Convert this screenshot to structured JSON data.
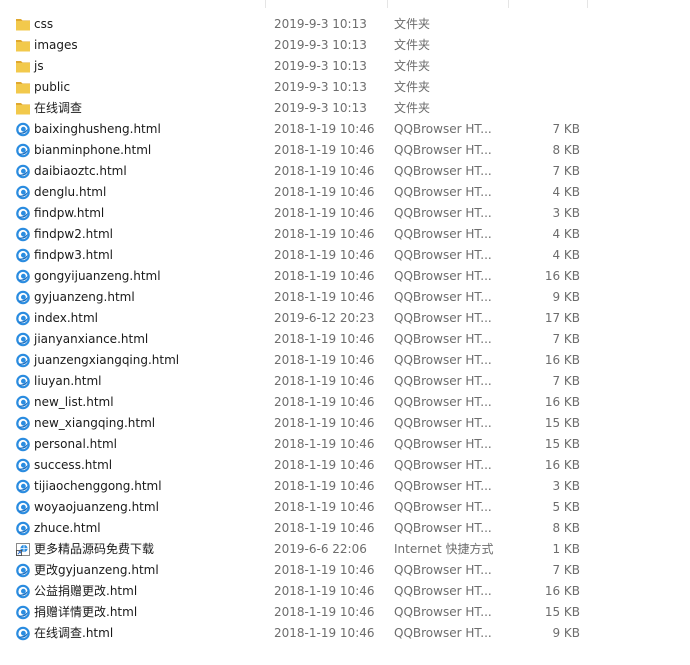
{
  "files": [
    {
      "name": "css",
      "date": "2019-9-3 10:13",
      "type": "文件夹",
      "size": "",
      "icon": "folder-icon"
    },
    {
      "name": "images",
      "date": "2019-9-3 10:13",
      "type": "文件夹",
      "size": "",
      "icon": "folder-icon"
    },
    {
      "name": "js",
      "date": "2019-9-3 10:13",
      "type": "文件夹",
      "size": "",
      "icon": "folder-icon"
    },
    {
      "name": "public",
      "date": "2019-9-3 10:13",
      "type": "文件夹",
      "size": "",
      "icon": "folder-icon"
    },
    {
      "name": "在线调查",
      "date": "2019-9-3 10:13",
      "type": "文件夹",
      "size": "",
      "icon": "folder-icon"
    },
    {
      "name": "baixinghusheng.html",
      "date": "2018-1-19 10:46",
      "type": "QQBrowser HT...",
      "size": "7 KB",
      "icon": "qqbrowser-html-icon"
    },
    {
      "name": "bianminphone.html",
      "date": "2018-1-19 10:46",
      "type": "QQBrowser HT...",
      "size": "8 KB",
      "icon": "qqbrowser-html-icon"
    },
    {
      "name": "daibiaoztc.html",
      "date": "2018-1-19 10:46",
      "type": "QQBrowser HT...",
      "size": "7 KB",
      "icon": "qqbrowser-html-icon"
    },
    {
      "name": "denglu.html",
      "date": "2018-1-19 10:46",
      "type": "QQBrowser HT...",
      "size": "4 KB",
      "icon": "qqbrowser-html-icon"
    },
    {
      "name": "findpw.html",
      "date": "2018-1-19 10:46",
      "type": "QQBrowser HT...",
      "size": "3 KB",
      "icon": "qqbrowser-html-icon"
    },
    {
      "name": "findpw2.html",
      "date": "2018-1-19 10:46",
      "type": "QQBrowser HT...",
      "size": "4 KB",
      "icon": "qqbrowser-html-icon"
    },
    {
      "name": "findpw3.html",
      "date": "2018-1-19 10:46",
      "type": "QQBrowser HT...",
      "size": "4 KB",
      "icon": "qqbrowser-html-icon"
    },
    {
      "name": "gongyijuanzeng.html",
      "date": "2018-1-19 10:46",
      "type": "QQBrowser HT...",
      "size": "16 KB",
      "icon": "qqbrowser-html-icon"
    },
    {
      "name": "gyjuanzeng.html",
      "date": "2018-1-19 10:46",
      "type": "QQBrowser HT...",
      "size": "9 KB",
      "icon": "qqbrowser-html-icon"
    },
    {
      "name": "index.html",
      "date": "2019-6-12 20:23",
      "type": "QQBrowser HT...",
      "size": "17 KB",
      "icon": "qqbrowser-html-icon"
    },
    {
      "name": "jianyanxiance.html",
      "date": "2018-1-19 10:46",
      "type": "QQBrowser HT...",
      "size": "7 KB",
      "icon": "qqbrowser-html-icon"
    },
    {
      "name": "juanzengxiangqing.html",
      "date": "2018-1-19 10:46",
      "type": "QQBrowser HT...",
      "size": "16 KB",
      "icon": "qqbrowser-html-icon"
    },
    {
      "name": "liuyan.html",
      "date": "2018-1-19 10:46",
      "type": "QQBrowser HT...",
      "size": "7 KB",
      "icon": "qqbrowser-html-icon"
    },
    {
      "name": "new_list.html",
      "date": "2018-1-19 10:46",
      "type": "QQBrowser HT...",
      "size": "16 KB",
      "icon": "qqbrowser-html-icon"
    },
    {
      "name": "new_xiangqing.html",
      "date": "2018-1-19 10:46",
      "type": "QQBrowser HT...",
      "size": "15 KB",
      "icon": "qqbrowser-html-icon"
    },
    {
      "name": "personal.html",
      "date": "2018-1-19 10:46",
      "type": "QQBrowser HT...",
      "size": "15 KB",
      "icon": "qqbrowser-html-icon"
    },
    {
      "name": "success.html",
      "date": "2018-1-19 10:46",
      "type": "QQBrowser HT...",
      "size": "16 KB",
      "icon": "qqbrowser-html-icon"
    },
    {
      "name": "tijiaochenggong.html",
      "date": "2018-1-19 10:46",
      "type": "QQBrowser HT...",
      "size": "3 KB",
      "icon": "qqbrowser-html-icon"
    },
    {
      "name": "woyaojuanzeng.html",
      "date": "2018-1-19 10:46",
      "type": "QQBrowser HT...",
      "size": "5 KB",
      "icon": "qqbrowser-html-icon"
    },
    {
      "name": "zhuce.html",
      "date": "2018-1-19 10:46",
      "type": "QQBrowser HT...",
      "size": "8 KB",
      "icon": "qqbrowser-html-icon"
    },
    {
      "name": "更多精品源码免费下载",
      "date": "2019-6-6 22:06",
      "type": "Internet 快捷方式",
      "size": "1 KB",
      "icon": "internet-shortcut-icon"
    },
    {
      "name": "更改gyjuanzeng.html",
      "date": "2018-1-19 10:46",
      "type": "QQBrowser HT...",
      "size": "7 KB",
      "icon": "qqbrowser-html-icon"
    },
    {
      "name": "公益捐赠更改.html",
      "date": "2018-1-19 10:46",
      "type": "QQBrowser HT...",
      "size": "16 KB",
      "icon": "qqbrowser-html-icon"
    },
    {
      "name": "捐赠详情更改.html",
      "date": "2018-1-19 10:46",
      "type": "QQBrowser HT...",
      "size": "15 KB",
      "icon": "qqbrowser-html-icon"
    },
    {
      "name": "在线调查.html",
      "date": "2018-1-19 10:46",
      "type": "QQBrowser HT...",
      "size": "9 KB",
      "icon": "qqbrowser-html-icon"
    }
  ],
  "colors": {
    "folder": "#f2c94c",
    "folder_dark": "#e0a82e",
    "qqbrowser_blue": "#2a8ce0",
    "text_primary": "#1a1a1a",
    "text_secondary": "#6d6d6d"
  }
}
